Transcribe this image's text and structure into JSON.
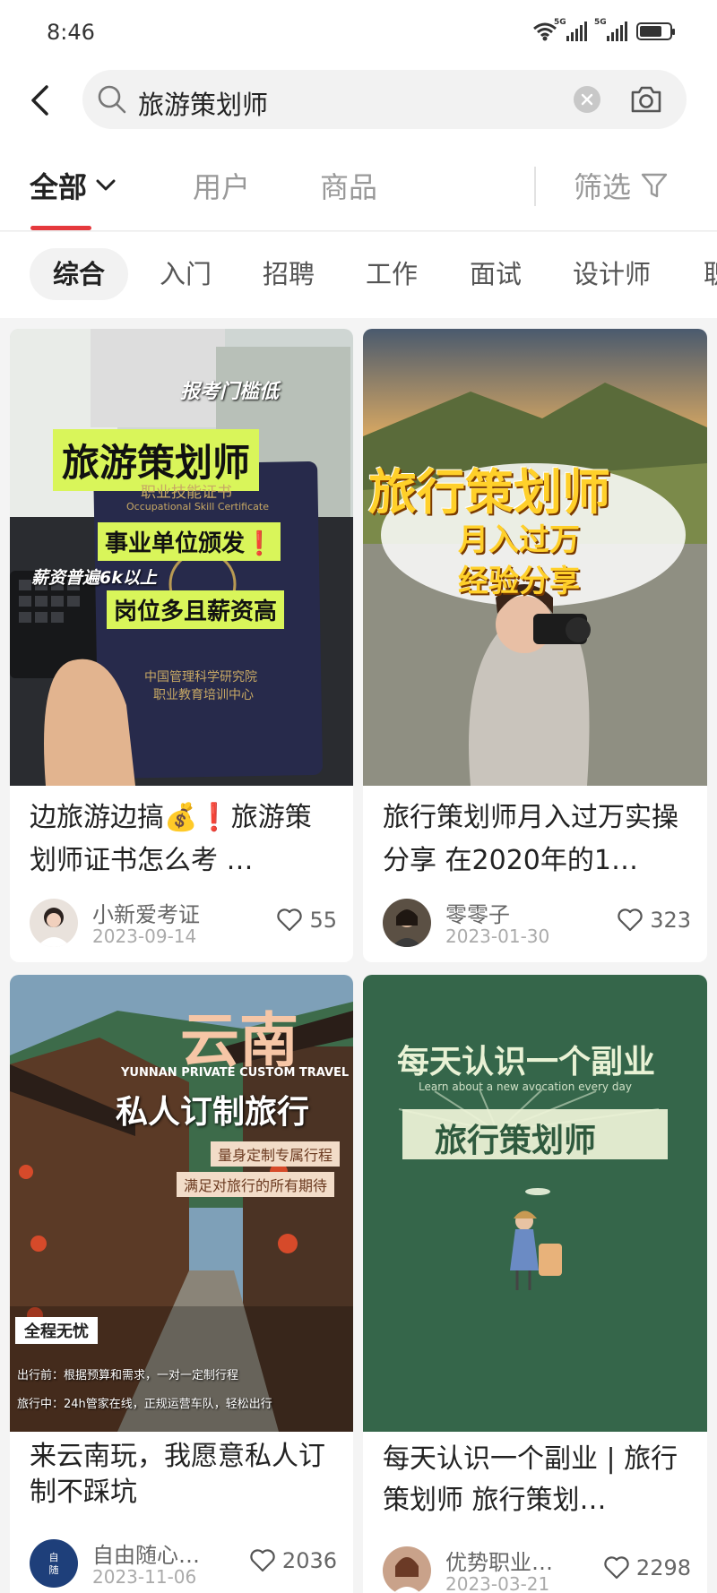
{
  "status": {
    "time": "8:46",
    "sig1_tag": "5G",
    "sig2_tag": "5G"
  },
  "search": {
    "query": "旅游策划师"
  },
  "tabs": {
    "all": "全部",
    "users": "用户",
    "goods": "商品",
    "filter": "筛选"
  },
  "chips": [
    "综合",
    "入门",
    "招聘",
    "工作",
    "面试",
    "设计师",
    "职"
  ],
  "posts": [
    {
      "title": "边旅游边搞💰❗旅游策划师证书怎么考 …",
      "author": "小新爱考证",
      "date": "2023-09-14",
      "likes": "55",
      "cover_text": {
        "top": "报考门槛低",
        "main": "旅游策划师",
        "cert": "职业技能证书",
        "cert_en": "Occupational Skill Certificate",
        "line1": "事业单位颁发❗",
        "salary": "薪资普遍6k以上",
        "line2": "岗位多且薪资高",
        "org1": "中国管理科学研究院",
        "org2": "职业教育培训中心"
      }
    },
    {
      "title": "旅行策划师月入过万实操分享 在2020年的1…",
      "author": "零零子",
      "date": "2023-01-30",
      "likes": "323",
      "cover_text": {
        "main": "旅行策划师",
        "line1": "月入过万",
        "line2": "经验分享"
      }
    },
    {
      "title": "来云南玩，我愿意私人订制不踩坑",
      "author": "自由随心…",
      "date": "2023-11-06",
      "likes": "2036",
      "cover_text": {
        "main": "云南",
        "en": "YUNNAN PRIVATE CUSTOM TRAVEL",
        "sub": "私人订制旅行",
        "tag1": "量身定制专属行程",
        "tag2": "满足对旅行的所有期待",
        "badge": "全程无忧",
        "item1": "出行前：根据预算和需求，一对一定制行程",
        "item2": "旅行中：24h管家在线，正规运营车队，轻松出行"
      }
    },
    {
      "title": "每天认识一个副业 | 旅行策划师 旅行策划…",
      "author": "优势职业…",
      "date": "2023-03-21",
      "likes": "2298",
      "cover_text": {
        "top": "每天认识一个副业",
        "en": "Learn about a new avocation every day",
        "main": "旅行策划师"
      }
    }
  ]
}
